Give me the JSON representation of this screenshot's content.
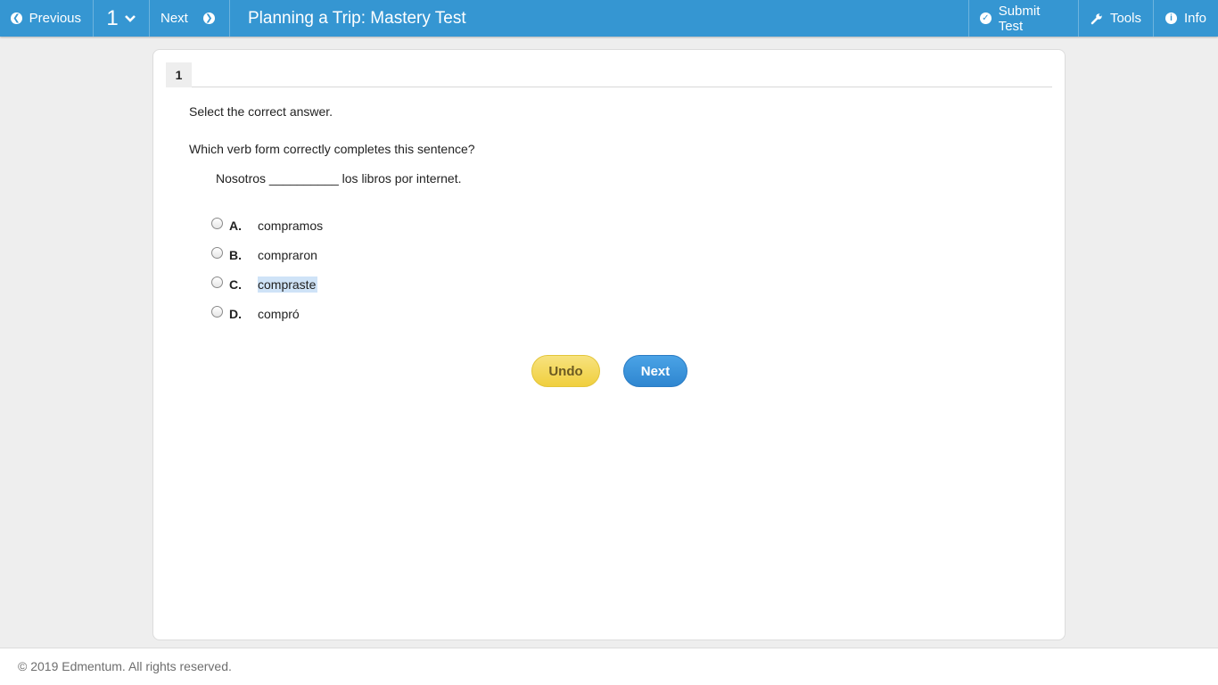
{
  "topbar": {
    "previous_label": "Previous",
    "question_number": "1",
    "next_label": "Next",
    "title": "Planning a Trip: Mastery Test",
    "submit_label": "Submit Test",
    "tools_label": "Tools",
    "info_label": "Info"
  },
  "question": {
    "tab_number": "1",
    "instruction": "Select the correct answer.",
    "prompt": "Which verb form correctly completes this sentence?",
    "sentence": "Nosotros __________ los libros por internet.",
    "options": [
      {
        "letter": "A.",
        "text": "compramos"
      },
      {
        "letter": "B.",
        "text": "compraron"
      },
      {
        "letter": "C.",
        "text": "compraste"
      },
      {
        "letter": "D.",
        "text": "compró"
      }
    ]
  },
  "actions": {
    "undo_label": "Undo",
    "next_label": "Next"
  },
  "footer": {
    "copyright": "© 2019 Edmentum. All rights reserved."
  },
  "colors": {
    "topbar": "#3596d2",
    "undo": "#f0cf3e",
    "next": "#2f86d0",
    "selection": "#cfe3f7"
  }
}
